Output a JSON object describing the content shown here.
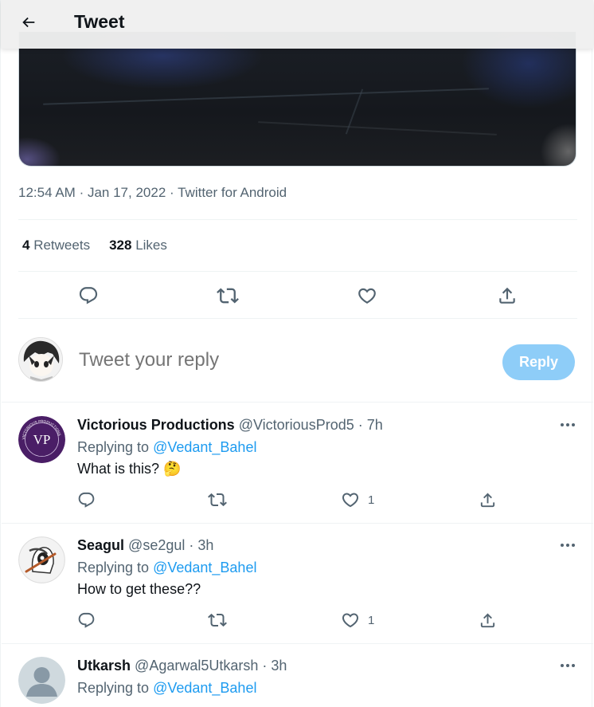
{
  "header": {
    "title": "Tweet"
  },
  "tweet": {
    "time": "12:54 AM",
    "date": "Jan 17, 2022",
    "source": "Twitter for Android",
    "separator": "·",
    "retweets": {
      "count": "4",
      "label": "Retweets"
    },
    "likes": {
      "count": "328",
      "label": "Likes"
    }
  },
  "composer": {
    "placeholder": "Tweet your reply",
    "reply_label": "Reply",
    "reply_button_color": "#8ecdf8"
  },
  "colors": {
    "accent": "#1d9bf0",
    "secondary_text": "#536471",
    "primary_text": "#0f1419"
  },
  "replies": [
    {
      "name": "Victorious Productions",
      "handle": "@VictoriousProd5",
      "time": "· 7h",
      "replying_prefix": "Replying to",
      "mention": "@Vedant_Bahel",
      "text": "What is this? 🤔",
      "likes": "1",
      "avatar_monogram": "VP",
      "avatar_ring_text": "VICTORIOUS PRODUCTIONS"
    },
    {
      "name": "Seagul",
      "handle": "@se2gul",
      "time": "· 3h",
      "replying_prefix": "Replying to",
      "mention": "@Vedant_Bahel",
      "text": "How to get these??",
      "likes": "1"
    },
    {
      "name": "Utkarsh",
      "handle": "@Agarwal5Utkarsh",
      "time": "· 3h",
      "replying_prefix": "Replying to",
      "mention": "@Vedant_Bahel"
    }
  ],
  "icons": [
    "back-arrow-icon",
    "reply-icon",
    "retweet-icon",
    "like-icon",
    "share-icon",
    "more-icon"
  ]
}
